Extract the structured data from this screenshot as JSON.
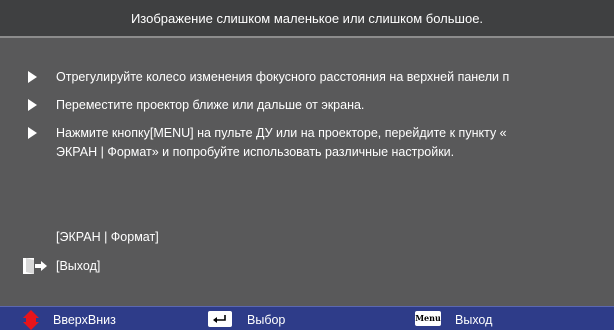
{
  "title": "Изображение слишком маленькое или слишком большое.",
  "steps": [
    {
      "text": "Отрегулируйте колесо изменения фокусного расстояния на верхней панели п"
    },
    {
      "text": "Переместите проектор ближе или дальше от экрана."
    },
    {
      "lines": [
        "Нажмите кнопку[MENU] на пульте ДУ или на проекторе, перейдите к пункту «",
        "ЭКРАН | Формат» и попробуйте использовать различные настройки."
      ]
    }
  ],
  "menu_path": "[ЭКРАН | Формат]",
  "exit_label": "[Выход]",
  "footer": {
    "nav_label": "ВверхВниз",
    "select_label": "Выбор",
    "menu_key": "Menu",
    "exit_label": "Выход"
  },
  "colors": {
    "background": "#59595a",
    "title_bar": "#3f4041",
    "footer_bar": "#2e3c89",
    "nav_icon": "#e8141b"
  },
  "icons": {
    "bullet": "play-triangle-icon",
    "exit": "exit-door-icon",
    "nav": "up-down-arrows-icon",
    "select": "enter-key-icon",
    "menu": "menu-key-icon"
  }
}
